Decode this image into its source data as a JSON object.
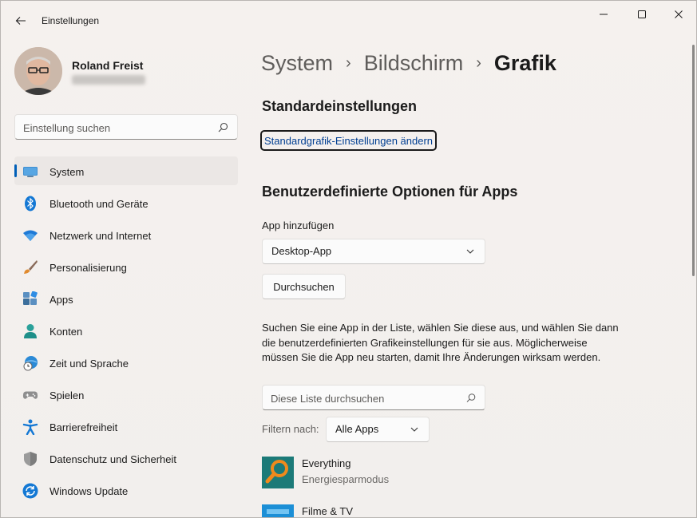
{
  "window": {
    "title": "Einstellungen"
  },
  "profile": {
    "name": "Roland Freist"
  },
  "search": {
    "placeholder": "Einstellung suchen"
  },
  "nav": {
    "items": [
      {
        "label": "System",
        "icon": "monitor-icon",
        "active": true
      },
      {
        "label": "Bluetooth und Geräte",
        "icon": "bluetooth-icon"
      },
      {
        "label": "Netzwerk und Internet",
        "icon": "wifi-icon"
      },
      {
        "label": "Personalisierung",
        "icon": "brush-icon"
      },
      {
        "label": "Apps",
        "icon": "apps-icon"
      },
      {
        "label": "Konten",
        "icon": "person-icon"
      },
      {
        "label": "Zeit und Sprache",
        "icon": "globe-clock-icon"
      },
      {
        "label": "Spielen",
        "icon": "gamepad-icon"
      },
      {
        "label": "Barrierefreiheit",
        "icon": "accessibility-icon"
      },
      {
        "label": "Datenschutz und Sicherheit",
        "icon": "shield-icon"
      },
      {
        "label": "Windows Update",
        "icon": "update-icon"
      }
    ]
  },
  "breadcrumb": {
    "items": [
      "System",
      "Bildschirm",
      "Grafik"
    ],
    "separator": "›"
  },
  "main": {
    "section1_title": "Standardeinstellungen",
    "default_link": "Standardgrafik-Einstellungen ändern",
    "section2_title": "Benutzerdefinierte Optionen für Apps",
    "add_app_label": "App hinzufügen",
    "app_type_selected": "Desktop-App",
    "browse_button": "Durchsuchen",
    "description": "Suchen Sie eine App in der Liste, wählen Sie diese aus, und wählen Sie dann die benutzerdefinierten Grafikeinstellungen für sie aus. Möglicherweise müssen Sie die App neu starten, damit Ihre Änderungen wirksam werden.",
    "list_search_placeholder": "Diese Liste durchsuchen",
    "filter_label": "Filtern nach:",
    "filter_selected": "Alle Apps",
    "apps": [
      {
        "name": "Everything",
        "mode": "Energiesparmodus",
        "icon": "everything-app-icon"
      },
      {
        "name": "Filme & TV",
        "mode": "",
        "icon": "movies-tv-app-icon"
      }
    ]
  },
  "colors": {
    "accent": "#005fb8",
    "link": "#003e92"
  }
}
